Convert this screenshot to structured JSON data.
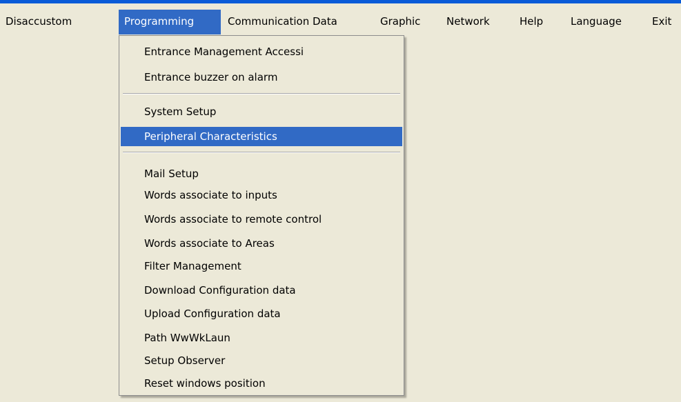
{
  "menubar": {
    "items": [
      {
        "label": "Disaccustom"
      },
      {
        "label": "Programming",
        "active": true
      },
      {
        "label": "Communication Data"
      },
      {
        "label": "Graphic"
      },
      {
        "label": "Network"
      },
      {
        "label": "Help"
      },
      {
        "label": "Language"
      },
      {
        "label": "Exit"
      }
    ]
  },
  "programming_menu": {
    "items": [
      {
        "label": "Entrance Management Accessi"
      },
      {
        "label": "Entrance buzzer on alarm"
      },
      {
        "label": "System Setup"
      },
      {
        "label": "Peripheral Characteristics",
        "selected": true
      },
      {
        "label": "Mail Setup"
      },
      {
        "label": "Words associate to inputs"
      },
      {
        "label": "Words associate to remote control"
      },
      {
        "label": "Words associate to Areas"
      },
      {
        "label": "Filter Management"
      },
      {
        "label": "Download Configuration data"
      },
      {
        "label": "Upload Configuration data"
      },
      {
        "label": "Path WwWkLaun"
      },
      {
        "label": "Setup Observer"
      },
      {
        "label": "Reset windows position"
      }
    ]
  },
  "colors": {
    "menu_background": "#ECE9D8",
    "highlight": "#316AC5",
    "highlight_text": "#FFFFFF",
    "title_strip": "#0A5BD8"
  }
}
